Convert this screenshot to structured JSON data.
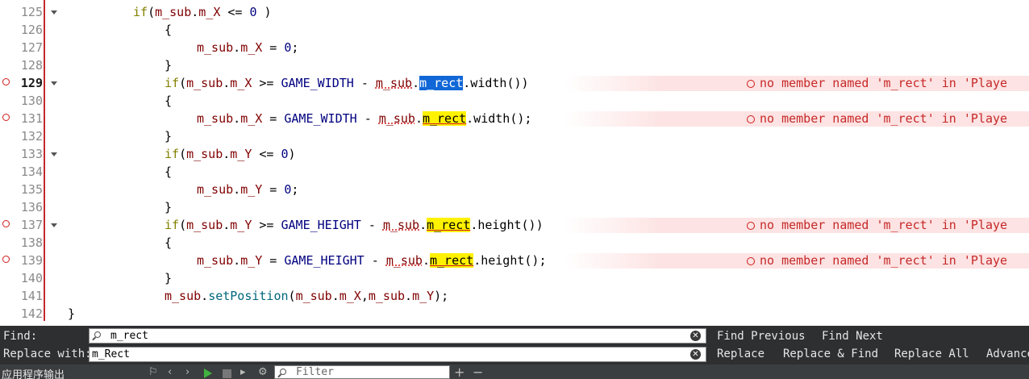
{
  "editor": {
    "lines": [
      {
        "num": "125",
        "error": false,
        "current": false,
        "fold": true
      },
      {
        "num": "126",
        "error": false,
        "current": false,
        "fold": false
      },
      {
        "num": "127",
        "error": false,
        "current": false,
        "fold": false
      },
      {
        "num": "128",
        "error": false,
        "current": false,
        "fold": false
      },
      {
        "num": "129",
        "error": true,
        "current": true,
        "fold": true
      },
      {
        "num": "130",
        "error": false,
        "current": false,
        "fold": false
      },
      {
        "num": "131",
        "error": true,
        "current": false,
        "fold": false
      },
      {
        "num": "132",
        "error": false,
        "current": false,
        "fold": false
      },
      {
        "num": "133",
        "error": false,
        "current": false,
        "fold": true
      },
      {
        "num": "134",
        "error": false,
        "current": false,
        "fold": false
      },
      {
        "num": "135",
        "error": false,
        "current": false,
        "fold": false
      },
      {
        "num": "136",
        "error": false,
        "current": false,
        "fold": false
      },
      {
        "num": "137",
        "error": true,
        "current": false,
        "fold": true
      },
      {
        "num": "138",
        "error": false,
        "current": false,
        "fold": false
      },
      {
        "num": "139",
        "error": true,
        "current": false,
        "fold": false
      },
      {
        "num": "140",
        "error": false,
        "current": false,
        "fold": false
      },
      {
        "num": "141",
        "error": false,
        "current": false,
        "fold": false
      },
      {
        "num": "142",
        "error": false,
        "current": false,
        "fold": false
      }
    ],
    "code": {
      "l125": {
        "kw": "if",
        "a": "(",
        "v1": "m_sub",
        "d": ".",
        "m": "m_X",
        "op": " <= ",
        "n": "0",
        "b": " )"
      },
      "l126": "{",
      "l127": {
        "v1": "m_sub",
        "d": ".",
        "m": "m_X",
        "op": " = ",
        "n": "0",
        "semi": ";"
      },
      "l128": "}",
      "l129": {
        "kw": "if",
        "a": "(",
        "v1": "m_sub",
        "d": ".",
        "m": "m_X",
        "op": " >= ",
        "mac": "GAME_WIDTH",
        "minus": " - ",
        "v2": "m_sub",
        "d2": ".",
        "hl": "m_rect",
        "rest": ".width())"
      },
      "l130": "{",
      "l131": {
        "v1": "m_sub",
        "d": ".",
        "m": "m_X",
        "op": " = ",
        "mac": "GAME_WIDTH",
        "minus": " - ",
        "v2": "m_sub",
        "d2": ".",
        "hl": "m_rect",
        "rest": ".width();"
      },
      "l132": "}",
      "l133": {
        "kw": "if",
        "a": "(",
        "v1": "m_sub",
        "d": ".",
        "m": "m_Y",
        "op": " <= ",
        "n": "0",
        "b": ")"
      },
      "l134": "{",
      "l135": {
        "v1": "m_sub",
        "d": ".",
        "m": "m_Y",
        "op": " = ",
        "n": "0",
        "semi": ";"
      },
      "l136": "}",
      "l137": {
        "kw": "if",
        "a": "(",
        "v1": "m_sub",
        "d": ".",
        "m": "m_Y",
        "op": " >= ",
        "mac": "GAME_HEIGHT",
        "minus": " - ",
        "v2": "m_sub",
        "d2": ".",
        "hl": "m_rect",
        "rest": ".height())"
      },
      "l138": "{",
      "l139": {
        "v1": "m_sub",
        "d": ".",
        "m": "m_Y",
        "op": " = ",
        "mac": "GAME_HEIGHT",
        "minus": " - ",
        "v2": "m_sub",
        "d2": ".",
        "hl": "m_rect",
        "rest": ".height();"
      },
      "l140": "}",
      "l141": {
        "v1": "m_sub",
        "d": ".",
        "fn": "setPosition",
        "a": "(",
        "v2": "m_sub",
        "d2": ".",
        "m": "m_X",
        "comma": ",",
        "v3": "m_sub",
        "d3": ".",
        "m2": "m_Y",
        "b": ");"
      },
      "l142": "}"
    },
    "error_message": "no member named 'm_rect' in 'Playe"
  },
  "findbar": {
    "find_label": "Find:",
    "find_value": "m_rect",
    "replace_label": "Replace with:",
    "replace_value": "m_Rect",
    "find_previous": "Find Previous",
    "find_next": "Find Next",
    "replace": "Replace",
    "replace_and_find": "Replace & Find",
    "replace_all": "Replace All",
    "advanced": "Advance"
  },
  "output": {
    "title": "应用程序输出",
    "filter_placeholder": "Filter",
    "add": "+",
    "remove": "−"
  },
  "colors": {
    "error_red": "#c62828",
    "highlight_yellow": "#fff200",
    "selection_blue": "#1167d6",
    "keyword": "#808000",
    "member": "#800000"
  },
  "icons": [
    "error-icon",
    "fold-arrow-icon",
    "search-icon",
    "clear-icon",
    "run-icon",
    "stop-icon",
    "settings-icon"
  ]
}
